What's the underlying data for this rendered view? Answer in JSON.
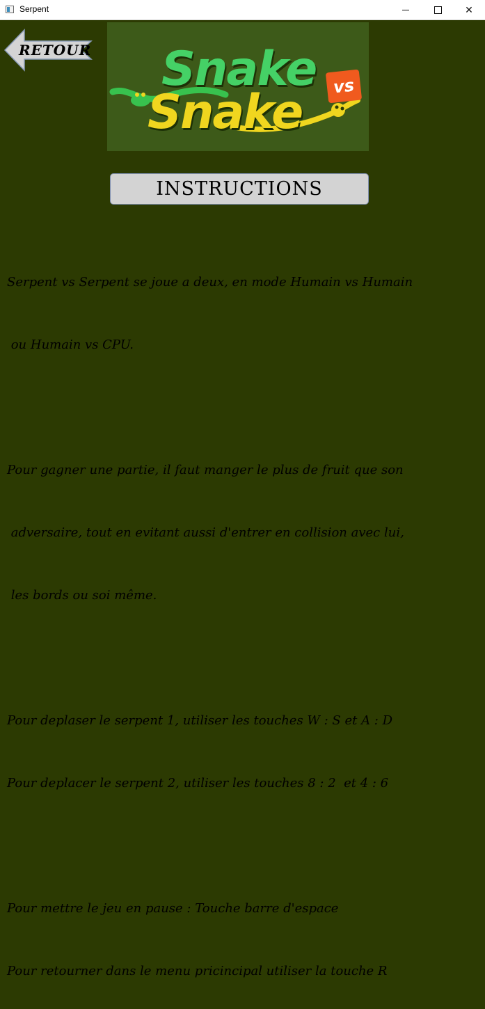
{
  "window": {
    "title": "Serpent"
  },
  "back_button": {
    "label": "RETOUR"
  },
  "logo": {
    "line1": "Snake",
    "vs": "vs",
    "line2": "Snake"
  },
  "instructions_button": {
    "label": "INSTRUCTIONS"
  },
  "paragraphs": [
    {
      "lines": [
        "Serpent vs Serpent se joue a deux, en mode Humain vs Humain",
        " ou Humain vs CPU."
      ]
    },
    {
      "lines": [
        "Pour gagner une partie, il faut manger le plus de fruit que son",
        " adversaire, tout en evitant aussi d'entrer en collision avec lui,",
        " les bords ou soi même."
      ]
    },
    {
      "lines": [
        "Pour deplaser le serpent 1, utiliser les touches W : S et A : D",
        "Pour deplacer le serpent 2, utiliser les touches 8 : 2  et 4 : 6"
      ]
    },
    {
      "lines": [
        "Pour mettre le jeu en pause : Touche barre d'espace",
        "Pour retourner dans le menu pricincipal utiliser la touche R"
      ]
    }
  ]
}
